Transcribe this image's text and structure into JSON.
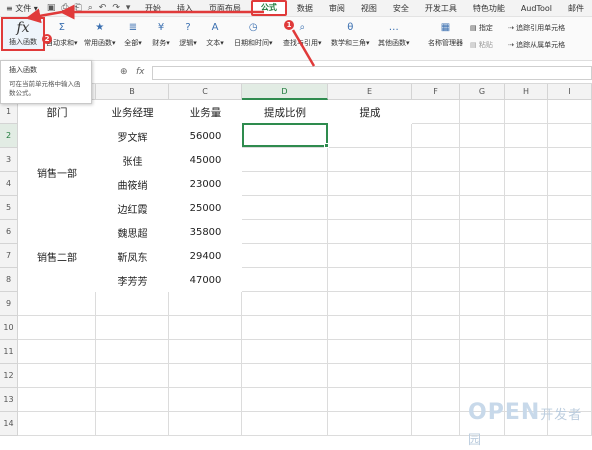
{
  "menubar": {
    "menu_icon": "≡",
    "file_label": "文件",
    "tabs": [
      "开始",
      "插入",
      "页面布局",
      "公式",
      "数据",
      "审阅",
      "视图",
      "安全",
      "开发工具",
      "特色功能",
      "AudTool",
      "邮件"
    ],
    "active_tab": "公式"
  },
  "ribbon": {
    "insert_function": {
      "icon": "fx",
      "label": "插入函数"
    },
    "buttons": [
      {
        "icon": "Σ",
        "label": "自动求和▾"
      },
      {
        "icon": "★",
        "label": "常用函数▾"
      },
      {
        "icon": "≣",
        "label": "全部▾"
      },
      {
        "icon": "¥",
        "label": "财务▾"
      },
      {
        "icon": "?",
        "label": "逻辑▾"
      },
      {
        "icon": "A",
        "label": "文本▾"
      },
      {
        "icon": "◷",
        "label": "日期和时间▾"
      },
      {
        "icon": "⌕",
        "label": "查找与引用▾"
      },
      {
        "icon": "θ",
        "label": "数学和三角▾"
      },
      {
        "icon": "…",
        "label": "其他函数▾"
      }
    ],
    "name_manager": {
      "icon": "▦",
      "label": "名称管理器"
    },
    "specify_label": "指定",
    "paste_label": "粘贴",
    "trace_precedents": "追踪引用单元格",
    "trace_dependents": "追踪从属单元格"
  },
  "annotations": {
    "badge1": "1",
    "badge2": "2",
    "accent": "#e03a3a"
  },
  "tooltip": {
    "title": "插入函数",
    "body": "可在当前单元格中输入函数公式。"
  },
  "formula_bar": {
    "zoom_icon": "⊕",
    "fx_label": "fx",
    "value": ""
  },
  "sheet": {
    "columns": [
      "A",
      "B",
      "C",
      "D",
      "E",
      "F",
      "G",
      "H",
      "I"
    ],
    "rows": [
      "1",
      "2",
      "3",
      "4",
      "5",
      "6",
      "7",
      "8",
      "9",
      "10",
      "11",
      "12",
      "13",
      "14"
    ],
    "headers": [
      "部门",
      "业务经理",
      "业务量",
      "提成比例",
      "提成"
    ],
    "departments": [
      "销售一部",
      "销售二部"
    ],
    "managers": [
      "罗文辉",
      "张佳",
      "曲筱绡",
      "边红霞",
      "魏思超",
      "靳凤东",
      "李芳芳"
    ],
    "volumes": [
      "56000",
      "45000",
      "23000",
      "25000",
      "35800",
      "29400",
      "47000"
    ],
    "selected_cell": "D2",
    "accent": "#2e8b4e"
  },
  "watermark": {
    "big": "OPEN",
    "small": "开发者园"
  }
}
